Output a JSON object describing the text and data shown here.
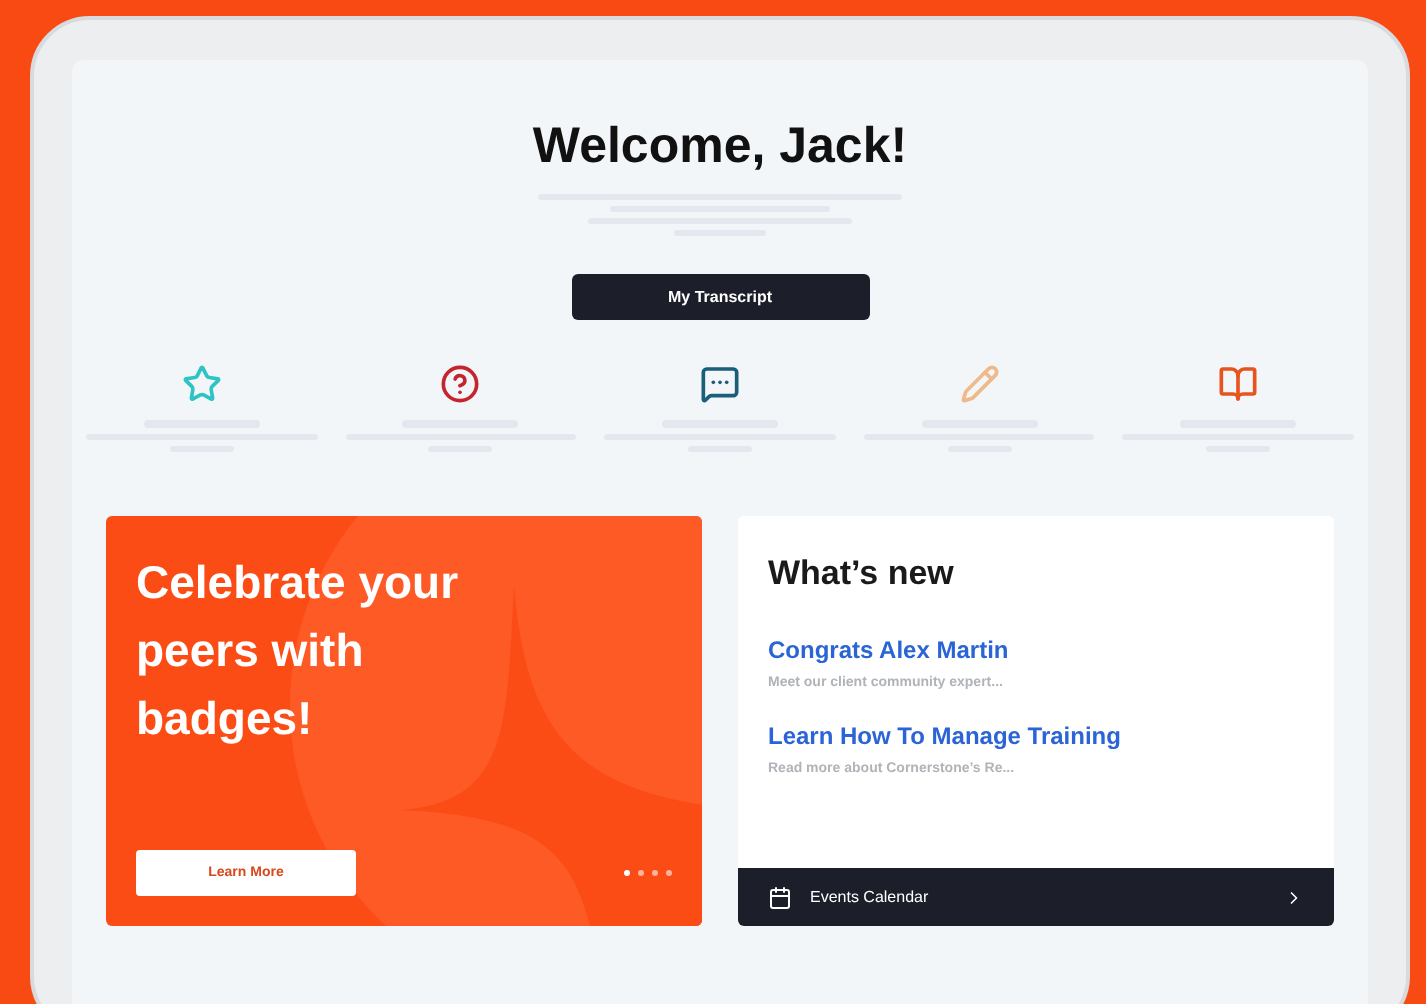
{
  "header": {
    "title": "Welcome, Jack!",
    "button": "My Transcript"
  },
  "shortcuts": [
    {
      "kind": "star",
      "color": "#2ec4c4"
    },
    {
      "kind": "question",
      "color": "#c4262e"
    },
    {
      "kind": "chat",
      "color": "#1b5e7a"
    },
    {
      "kind": "pencil",
      "color": "#f0b98a"
    },
    {
      "kind": "book",
      "color": "#e8541e"
    }
  ],
  "promo": {
    "title": "Celebrate your peers with badges!",
    "button": "Learn More",
    "dots": [
      {
        "selected": true
      },
      {
        "selected": false
      },
      {
        "selected": false
      },
      {
        "selected": false
      }
    ]
  },
  "whats_new": {
    "title": "What’s new",
    "items": [
      {
        "title": "Congrats Alex Martin",
        "summary": "Meet our client community expert..."
      },
      {
        "title": "Learn How To Manage Training",
        "summary": "Read more about Cornerstone’s Re..."
      }
    ],
    "footer": "Events Calendar"
  }
}
